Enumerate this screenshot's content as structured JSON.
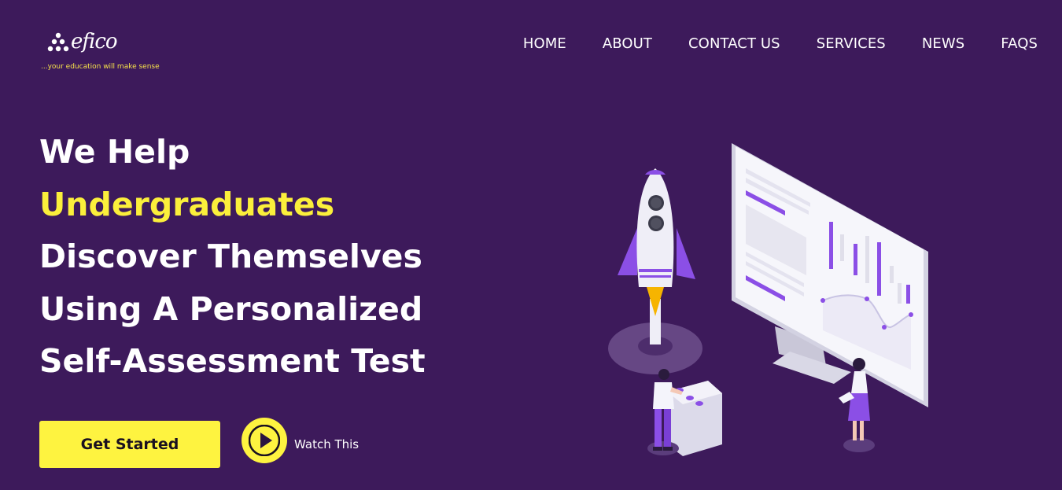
{
  "brand": {
    "name": "efico",
    "tagline": "...your education will make sense"
  },
  "nav": {
    "items": [
      "HOME",
      "ABOUT",
      "CONTACT US",
      "SERVICES",
      "NEWS",
      "FAQS"
    ]
  },
  "hero": {
    "line1": "We Help",
    "line2": "Undergraduates",
    "line3": "Discover Themselves",
    "line4": "Using A Personalized",
    "line5": "Self-Assessment Test"
  },
  "cta": {
    "primary_label": "Get Started",
    "secondary_label": "Watch This"
  },
  "colors": {
    "background": "#3d1a5b",
    "accent": "#fef340",
    "illustration_purple": "#8b4fe6"
  },
  "icons": {
    "logo": "people-dots-icon",
    "play": "play-icon"
  }
}
